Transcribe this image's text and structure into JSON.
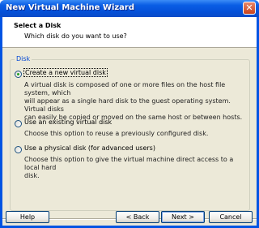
{
  "window": {
    "title": "New Virtual Machine Wizard",
    "close_label": "✕"
  },
  "header": {
    "title": "Select a Disk",
    "subtitle": "Which disk do you want to use?"
  },
  "group": {
    "legend": "Disk",
    "options": [
      {
        "label": "Create a new virtual disk",
        "selected": true,
        "description": [
          "A virtual disk is composed of one or more files on the host file system, which",
          "will appear as a single hard disk to the guest operating system. Virtual disks",
          "can easily be copied or moved on the same host or between hosts."
        ]
      },
      {
        "label": "Use an existing virtual disk",
        "selected": false,
        "description": [
          "Choose this option to reuse a previously configured disk."
        ]
      },
      {
        "label": "Use a physical disk (for advanced users)",
        "selected": false,
        "description": [
          "Choose this option to give the virtual machine direct access to a local hard",
          "disk."
        ]
      }
    ]
  },
  "buttons": {
    "help": "Help",
    "back": "< Back",
    "next": "Next >",
    "cancel": "Cancel"
  }
}
